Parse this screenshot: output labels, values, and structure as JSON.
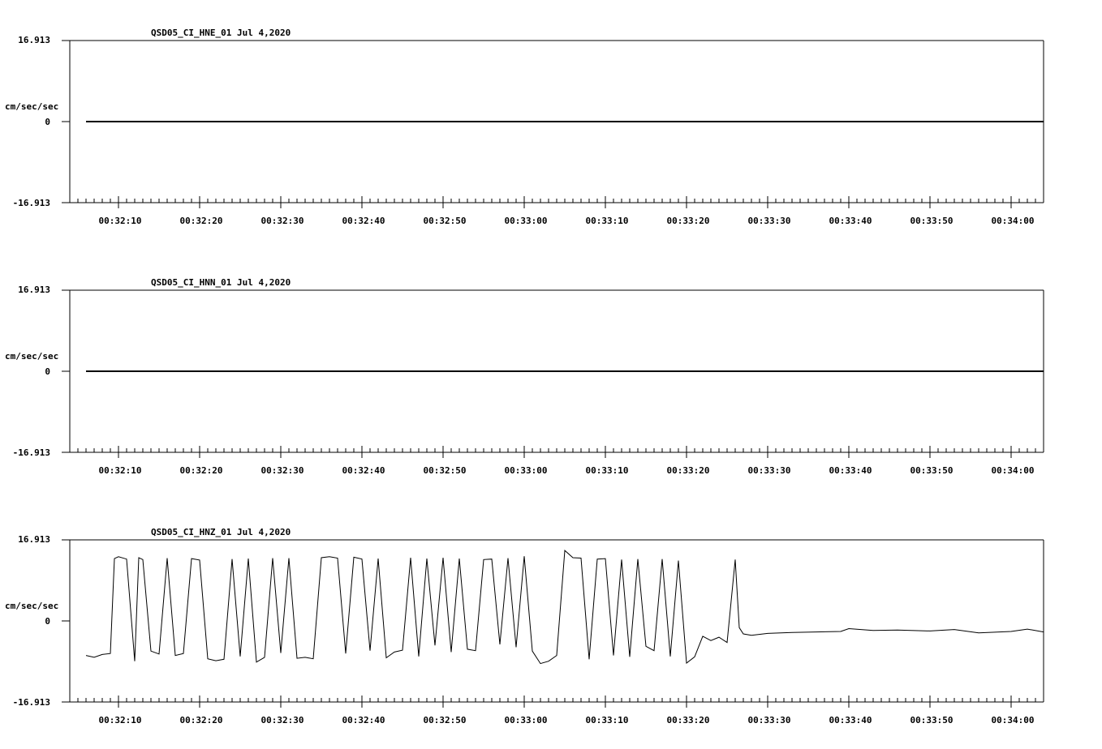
{
  "chart_data": [
    {
      "type": "line",
      "title": "QSD05_CI_HNE_01  Jul 4,2020",
      "ylabel": "cm/sec/sec",
      "y_ticks": [
        "16.913",
        "0",
        "-16.913"
      ],
      "ylim": [
        -16.913,
        16.913
      ],
      "x_ticks": [
        "00:32:10",
        "00:32:20",
        "00:32:30",
        "00:32:40",
        "00:32:50",
        "00:33:00",
        "00:33:10",
        "00:33:20",
        "00:33:30",
        "00:33:40",
        "00:33:50",
        "00:34:00"
      ],
      "x_range": [
        "00:32:04",
        "00:34:04"
      ],
      "series": [
        {
          "x": [
            "00:32:06",
            "00:34:04"
          ],
          "values": [
            0,
            0
          ]
        }
      ]
    },
    {
      "type": "line",
      "title": "QSD05_CI_HNN_01  Jul 4,2020",
      "ylabel": "cm/sec/sec",
      "y_ticks": [
        "16.913",
        "0",
        "-16.913"
      ],
      "ylim": [
        -16.913,
        16.913
      ],
      "x_ticks": [
        "00:32:10",
        "00:32:20",
        "00:32:30",
        "00:32:40",
        "00:32:50",
        "00:33:00",
        "00:33:10",
        "00:33:20",
        "00:33:30",
        "00:33:40",
        "00:33:50",
        "00:34:00"
      ],
      "x_range": [
        "00:32:04",
        "00:34:04"
      ],
      "series": [
        {
          "x": [
            "00:32:06",
            "00:34:04"
          ],
          "values": [
            0,
            0
          ]
        }
      ]
    },
    {
      "type": "line",
      "title": "QSD05_CI_HNZ_01  Jul 4,2020",
      "ylabel": "cm/sec/sec",
      "y_ticks": [
        "16.913",
        "0",
        "-16.913"
      ],
      "ylim": [
        -16.913,
        16.913
      ],
      "x_ticks": [
        "00:32:10",
        "00:32:20",
        "00:32:30",
        "00:32:40",
        "00:32:50",
        "00:33:00",
        "00:33:10",
        "00:33:20",
        "00:33:30",
        "00:33:40",
        "00:33:50",
        "00:34:00"
      ],
      "x_range": [
        "00:32:04",
        "00:34:04"
      ],
      "series": [
        {
          "x": [
            "00:32:06",
            "00:32:07",
            "00:32:08",
            "00:32:09",
            "00:32:09.5",
            "00:32:10",
            "00:32:11",
            "00:32:12",
            "00:32:12.5",
            "00:32:13",
            "00:32:14",
            "00:32:15",
            "00:32:16",
            "00:32:17",
            "00:32:18",
            "00:32:19",
            "00:32:20",
            "00:32:21",
            "00:32:22",
            "00:32:23",
            "00:32:24",
            "00:32:25",
            "00:32:26",
            "00:32:27",
            "00:32:28",
            "00:32:29",
            "00:32:30",
            "00:32:31",
            "00:32:32",
            "00:32:33",
            "00:32:34",
            "00:32:35",
            "00:32:36",
            "00:32:37",
            "00:32:38",
            "00:32:39",
            "00:32:40",
            "00:32:41",
            "00:32:42",
            "00:32:43",
            "00:32:44",
            "00:32:45",
            "00:32:46",
            "00:32:47",
            "00:32:48",
            "00:32:49",
            "00:32:50",
            "00:32:51",
            "00:32:52",
            "00:32:53",
            "00:32:54",
            "00:32:55",
            "00:32:56",
            "00:32:57",
            "00:32:58",
            "00:32:59",
            "00:33:00",
            "00:33:01",
            "00:33:02",
            "00:33:03",
            "00:33:04",
            "00:33:05",
            "00:33:06",
            "00:33:07",
            "00:33:08",
            "00:33:09",
            "00:33:10",
            "00:33:11",
            "00:33:12",
            "00:33:13",
            "00:33:14",
            "00:33:15",
            "00:33:16",
            "00:33:17",
            "00:33:18",
            "00:33:19",
            "00:33:20",
            "00:33:21",
            "00:33:22",
            "00:33:23",
            "00:33:24",
            "00:33:25",
            "00:33:26",
            "00:33:26.5",
            "00:33:27",
            "00:33:28",
            "00:33:30",
            "00:33:33",
            "00:33:36",
            "00:33:39",
            "00:33:40",
            "00:33:43",
            "00:33:46",
            "00:33:50",
            "00:33:53",
            "00:33:56",
            "00:34:00",
            "00:34:02",
            "00:34:04"
          ],
          "values": [
            -7.2,
            -7.6,
            -7.0,
            -6.8,
            13.0,
            13.4,
            12.9,
            -8.4,
            13.2,
            12.8,
            -6.3,
            -6.9,
            13.1,
            -7.2,
            -6.8,
            13.0,
            12.7,
            -7.9,
            -8.3,
            -8.0,
            12.9,
            -7.4,
            13.0,
            -8.6,
            -7.6,
            13.1,
            -6.7,
            13.1,
            -7.8,
            -7.6,
            -7.9,
            13.2,
            13.4,
            13.1,
            -6.8,
            13.3,
            12.9,
            -6.2,
            13.0,
            -7.7,
            -6.5,
            -6.1,
            13.2,
            -7.4,
            13.0,
            -5.1,
            13.2,
            -6.5,
            13.0,
            -5.9,
            -6.2,
            12.8,
            12.9,
            -4.9,
            13.1,
            -5.5,
            13.5,
            -6.3,
            -8.9,
            -8.4,
            -7.2,
            14.7,
            13.2,
            13.1,
            -8.0,
            12.9,
            13.0,
            -7.2,
            12.8,
            -7.5,
            12.9,
            -5.3,
            -6.2,
            12.9,
            -7.4,
            12.6,
            -8.8,
            -7.5,
            -3.2,
            -4.1,
            -3.4,
            -4.5,
            12.8,
            -1.4,
            -2.7,
            -3.0,
            -2.6,
            -2.4,
            -2.3,
            -2.2,
            -1.6,
            -2.0,
            -1.9,
            -2.1,
            -1.8,
            -2.5,
            -2.2,
            -1.7,
            -2.3
          ]
        }
      ]
    }
  ]
}
